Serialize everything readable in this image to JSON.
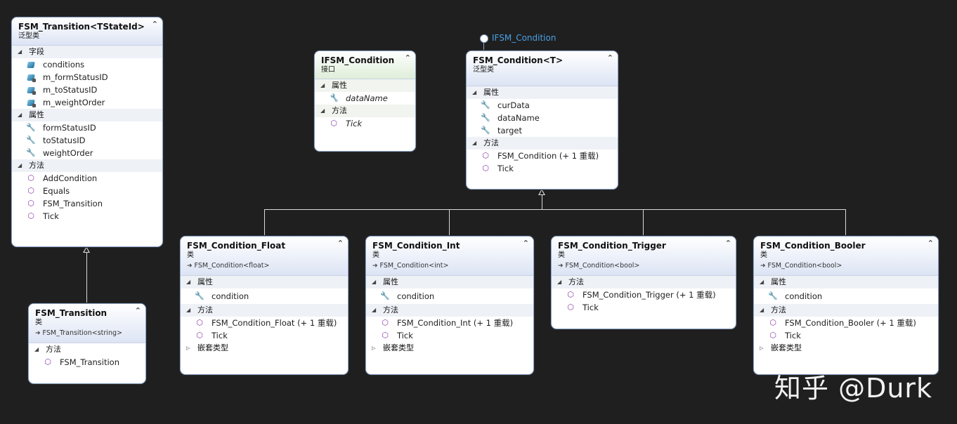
{
  "labels": {
    "fields": "字段",
    "properties": "属性",
    "methods": "方法",
    "nested_types": "嵌套类型"
  },
  "icons": {
    "field": "field-icon",
    "private_field": "private-field-icon",
    "property": "wrench-icon",
    "method": "method-cube-icon",
    "collapse": "double-chevron-up-icon",
    "inherit": "inherit-arrow-icon"
  },
  "colors": {
    "background": "#1f1f1f",
    "card_border": "#8aa3c8",
    "lollipop_label": "#4aa0e6",
    "method_icon": "#8a3ea8"
  },
  "interface_lollipop": {
    "label": "IFSM_Condition"
  },
  "classes": {
    "fsm_transition_generic": {
      "title": "FSM_Transition<TStateId>",
      "kind": "泛型类",
      "fields": [
        "conditions",
        "m_formStatusID",
        "m_toStatusID",
        "m_weightOrder"
      ],
      "properties": [
        "formStatusID",
        "toStatusID",
        "weightOrder"
      ],
      "methods": [
        "AddCondition",
        "Equals",
        "FSM_Transition",
        "Tick"
      ]
    },
    "fsm_transition": {
      "title": "FSM_Transition",
      "kind": "类",
      "base": "FSM_Transition<string>",
      "methods": [
        "FSM_Transition"
      ]
    },
    "ifsm_condition": {
      "title": "IFSM_Condition",
      "kind": "接口",
      "properties": [
        "dataName"
      ],
      "methods": [
        "Tick"
      ]
    },
    "fsm_condition_generic": {
      "title": "FSM_Condition<T>",
      "kind": "泛型类",
      "properties": [
        "curData",
        "dataName",
        "target"
      ],
      "methods": [
        "FSM_Condition (+ 1 重载)",
        "Tick"
      ]
    },
    "fsm_condition_float": {
      "title": "FSM_Condition_Float",
      "kind": "类",
      "base": "FSM_Condition<float>",
      "properties": [
        "condition"
      ],
      "methods": [
        "FSM_Condition_Float (+ 1 重载)",
        "Tick"
      ]
    },
    "fsm_condition_int": {
      "title": "FSM_Condition_Int",
      "kind": "类",
      "base": "FSM_Condition<int>",
      "properties": [
        "condition"
      ],
      "methods": [
        "FSM_Condition_Int (+ 1 重载)",
        "Tick"
      ]
    },
    "fsm_condition_trigger": {
      "title": "FSM_Condition_Trigger",
      "kind": "类",
      "base": "FSM_Condition<bool>",
      "methods": [
        "FSM_Condition_Trigger (+ 1 重载)",
        "Tick"
      ]
    },
    "fsm_condition_booler": {
      "title": "FSM_Condition_Booler",
      "kind": "类",
      "base": "FSM_Condition<bool>",
      "properties": [
        "condition"
      ],
      "methods": [
        "FSM_Condition_Booler (+ 1 重载)",
        "Tick"
      ]
    }
  },
  "watermark": "知乎 @Durk"
}
